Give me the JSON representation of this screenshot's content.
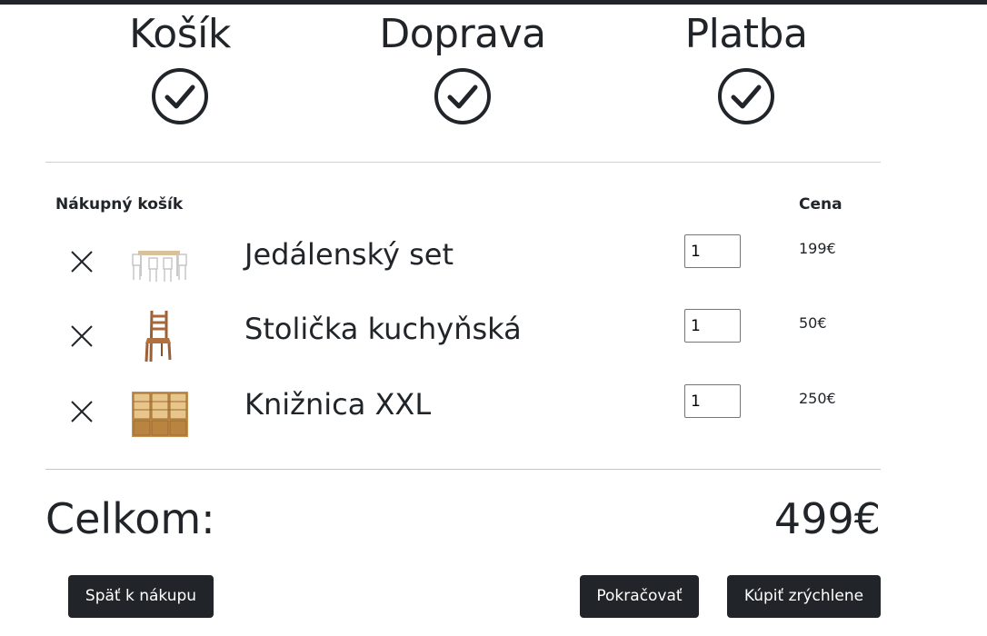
{
  "steps": [
    {
      "title": "Košík"
    },
    {
      "title": "Doprava"
    },
    {
      "title": "Platba"
    }
  ],
  "cart": {
    "heading": "Nákupný košík",
    "price_heading": "Cena",
    "items": [
      {
        "name": "Jedálenský set",
        "quantity": "1",
        "price": "199€"
      },
      {
        "name": "Stolička kuchyňská",
        "quantity": "1",
        "price": "50€"
      },
      {
        "name": "Knižnica XXL",
        "quantity": "1",
        "price": "250€"
      }
    ]
  },
  "summary": {
    "total_label": "Celkom:",
    "total_value": "499€"
  },
  "buttons": {
    "back": "Späť k nákupu",
    "continue": "Pokračovať",
    "quick_buy": "Kúpiť zrýchlene"
  }
}
